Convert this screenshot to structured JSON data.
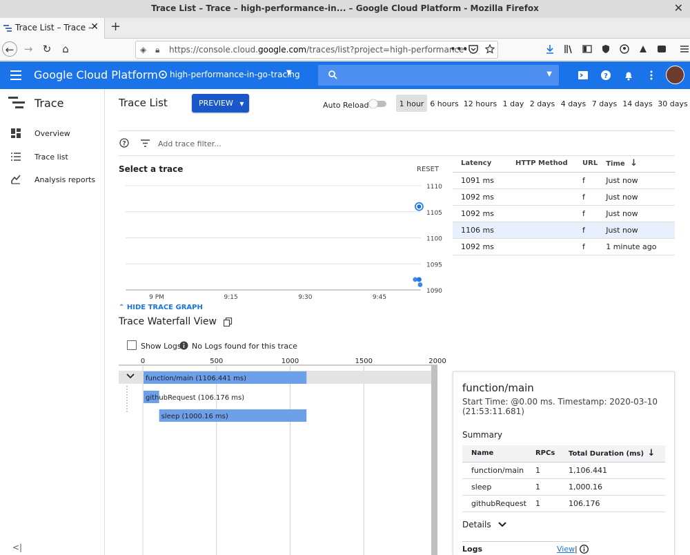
{
  "window": {
    "title": "Trace List – Trace – high-performance-in... – Google Cloud Platform - Mozilla Firefox"
  },
  "browser": {
    "tab_label": "Trace List – Trace –",
    "url_prefix": "https://console.cloud.",
    "url_domain": "google.com",
    "url_suffix": "/traces/list?project=high-performance-"
  },
  "header": {
    "brand": "Google Cloud Platform",
    "project": "high-performance-in-go-tracing"
  },
  "sidebar": {
    "title": "Trace",
    "items": [
      {
        "label": "Overview",
        "icon": "dashboard-icon"
      },
      {
        "label": "Trace list",
        "icon": "list-icon"
      },
      {
        "label": "Analysis reports",
        "icon": "chart-icon"
      }
    ]
  },
  "toolbar": {
    "page_title": "Trace List",
    "preview_label": "PREVIEW",
    "auto_reload": "Auto Reload",
    "ranges": [
      "1 hour",
      "6 hours",
      "12 hours",
      "1 day",
      "2 days",
      "4 days",
      "7 days",
      "14 days",
      "30 days"
    ],
    "active_range": "1 hour",
    "filter_placeholder": "Add trace filter..."
  },
  "graph": {
    "select_label": "Select a trace",
    "reset_label": "RESET",
    "hide_label": "HIDE TRACE GRAPH"
  },
  "chart_data": {
    "type": "scatter",
    "title": "",
    "xlabel": "",
    "ylabel": "",
    "x_ticks": [
      "9 PM",
      "9:15",
      "9:30",
      "9:45"
    ],
    "y_ticks": [
      1090,
      1095,
      1100,
      1105,
      1110
    ],
    "ylim": [
      1090,
      1110
    ],
    "grid": true,
    "points": [
      {
        "x": "9:53",
        "y": 1106,
        "selected": true
      },
      {
        "x": "9:52",
        "y": 1092
      },
      {
        "x": "9:53",
        "y": 1092
      },
      {
        "x": "9:53",
        "y": 1091
      },
      {
        "x": "9:53",
        "y": 1092
      }
    ],
    "colors": {
      "point": "#1a73e8"
    }
  },
  "trace_table": {
    "columns": [
      "Latency",
      "HTTP Method",
      "URL",
      "Time"
    ],
    "rows": [
      {
        "latency": "1091 ms",
        "method": "",
        "url": "f",
        "time": "Just now"
      },
      {
        "latency": "1092 ms",
        "method": "",
        "url": "f",
        "time": "Just now"
      },
      {
        "latency": "1092 ms",
        "method": "",
        "url": "f",
        "time": "Just now"
      },
      {
        "latency": "1106 ms",
        "method": "",
        "url": "f",
        "time": "Just now",
        "selected": true
      },
      {
        "latency": "1092 ms",
        "method": "",
        "url": "f",
        "time": "1 minute ago"
      }
    ]
  },
  "waterfall": {
    "title": "Trace Waterfall View",
    "show_logs": "Show Logs",
    "no_logs": "No Logs found for this trace",
    "axis": {
      "ticks": [
        "0",
        "500",
        "1000",
        "1500",
        "2000"
      ],
      "max": 2000
    },
    "spans": [
      {
        "label": "function/main (1106.441 ms)",
        "start": 0,
        "duration": 1106.441
      },
      {
        "label": "githubRequest (106.176 ms)",
        "start": 0,
        "duration": 106.176
      },
      {
        "label": "sleep (1000.16 ms)",
        "start": 106.176,
        "duration": 1000.16
      }
    ],
    "bar_color": "#6ea0ea"
  },
  "details": {
    "name": "function/main",
    "start": "Start Time: @0.00 ms. Timestamp: 2020-03-10 (21:53:11.681)",
    "summary_title": "Summary",
    "summary_columns": [
      "Name",
      "RPCs",
      "Total Duration (ms)"
    ],
    "summary_rows": [
      {
        "name": "function/main",
        "rpcs": "1",
        "total": "1,106.441"
      },
      {
        "name": "sleep",
        "rpcs": "1",
        "total": "1,000.16"
      },
      {
        "name": "githubRequest",
        "rpcs": "1",
        "total": "106.176"
      }
    ],
    "details_label": "Details",
    "logs_label": "Logs",
    "view_label": "View",
    "view_sep": "|"
  }
}
